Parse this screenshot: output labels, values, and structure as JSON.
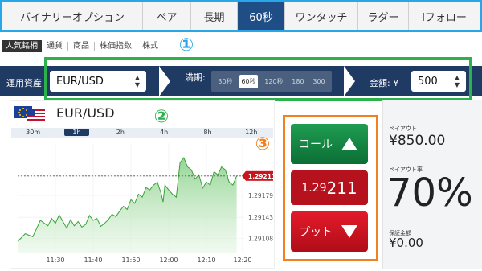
{
  "nav": {
    "tabs": [
      {
        "label": "バイナリーオプション",
        "active": false
      },
      {
        "label": "ペア",
        "active": false
      },
      {
        "label": "長期",
        "active": false
      },
      {
        "label": "60秒",
        "active": true
      },
      {
        "label": "ワンタッチ",
        "active": false
      },
      {
        "label": "ラダー",
        "active": false
      },
      {
        "label": "Iフォロー",
        "active": false
      }
    ]
  },
  "subnav": {
    "items": [
      {
        "label": "人気銘柄",
        "active": true
      },
      {
        "label": "通貨",
        "active": false
      },
      {
        "label": "商品",
        "active": false
      },
      {
        "label": "株価指数",
        "active": false
      },
      {
        "label": "株式",
        "active": false
      }
    ]
  },
  "markers": {
    "m1": "①",
    "m2": "②",
    "m3": "③"
  },
  "controls": {
    "asset_label": "運用資産",
    "asset_value": "EUR/USD",
    "expiry_label": "満期:",
    "expiry_options": [
      {
        "label": "30秒",
        "active": false
      },
      {
        "label": "60秒",
        "active": true
      },
      {
        "label": "120秒",
        "active": false
      },
      {
        "label": "180",
        "active": false
      },
      {
        "label": "300",
        "active": false
      }
    ],
    "amount_label": "金額: ¥",
    "amount_value": "500"
  },
  "chart": {
    "pair": "EUR/USD",
    "timeframes": [
      {
        "label": "30m",
        "active": false
      },
      {
        "label": "1h",
        "active": true
      },
      {
        "label": "2h",
        "active": false
      },
      {
        "label": "4h",
        "active": false
      },
      {
        "label": "8h",
        "active": false
      },
      {
        "label": "12h",
        "active": false
      }
    ],
    "current_price_label": "1.29211"
  },
  "chart_data": {
    "type": "area",
    "x_ticks": [
      "11:30",
      "11:40",
      "11:50",
      "12:00",
      "12:10",
      "12:20"
    ],
    "y_ticks": [
      "1.29211",
      "1.29179",
      "1.29143",
      "1.29108"
    ],
    "ylim": [
      1.29085,
      1.29265
    ],
    "xlim": [
      0,
      60
    ],
    "reference_value": 1.29211,
    "series": [
      {
        "name": "",
        "points": [
          [
            0,
            1.29103
          ],
          [
            2,
            1.29116
          ],
          [
            4,
            1.29111
          ],
          [
            6,
            1.29138
          ],
          [
            8,
            1.29129
          ],
          [
            9,
            1.29141
          ],
          [
            10,
            1.29133
          ],
          [
            11,
            1.29147
          ],
          [
            12,
            1.29136
          ],
          [
            13,
            1.29125
          ],
          [
            14,
            1.29139
          ],
          [
            15,
            1.29129
          ],
          [
            16,
            1.29136
          ],
          [
            17,
            1.29127
          ],
          [
            18,
            1.29131
          ],
          [
            19,
            1.29146
          ],
          [
            20,
            1.29138
          ],
          [
            21,
            1.29141
          ],
          [
            22,
            1.29128
          ],
          [
            23,
            1.29133
          ],
          [
            24,
            1.29139
          ],
          [
            25,
            1.29148
          ],
          [
            26,
            1.29144
          ],
          [
            27,
            1.29153
          ],
          [
            28,
            1.29161
          ],
          [
            29,
            1.29156
          ],
          [
            30,
            1.29172
          ],
          [
            31,
            1.29166
          ],
          [
            32,
            1.29181
          ],
          [
            33,
            1.29176
          ],
          [
            34,
            1.29192
          ],
          [
            35,
            1.29188
          ],
          [
            36,
            1.29196
          ],
          [
            37,
            1.29201
          ],
          [
            38,
            1.29182
          ],
          [
            38.5,
            1.29168
          ],
          [
            39,
            1.29196
          ],
          [
            40,
            1.29188
          ],
          [
            41,
            1.29181
          ],
          [
            42,
            1.29176
          ],
          [
            43,
            1.29233
          ],
          [
            44,
            1.29241
          ],
          [
            45,
            1.29226
          ],
          [
            46,
            1.29221
          ],
          [
            47,
            1.29206
          ],
          [
            48,
            1.29213
          ],
          [
            49,
            1.29191
          ],
          [
            50,
            1.29201
          ],
          [
            51,
            1.29196
          ],
          [
            52,
            1.29218
          ],
          [
            53,
            1.29213
          ],
          [
            54,
            1.29226
          ],
          [
            55,
            1.29221
          ],
          [
            56,
            1.29201
          ],
          [
            57,
            1.29196
          ],
          [
            58,
            1.29211
          ]
        ]
      }
    ]
  },
  "trade": {
    "call_label": "コール",
    "put_label": "プット",
    "price_prefix": "1.29",
    "price_suffix": "211"
  },
  "payout": {
    "payout_label": "ペイアウト",
    "payout_value": "¥850.00",
    "rate_label": "ペイアウト率",
    "rate_value": "70%",
    "guarantee_label": "保証金額",
    "guarantee_value": "¥0.00"
  },
  "colors": {
    "nav_active": "#1f4e86",
    "blue_outline": "#29a6e8",
    "green_outline": "#2bb24c",
    "orange_outline": "#f08020",
    "call": "#1f9d52",
    "put": "#e31a2a"
  }
}
